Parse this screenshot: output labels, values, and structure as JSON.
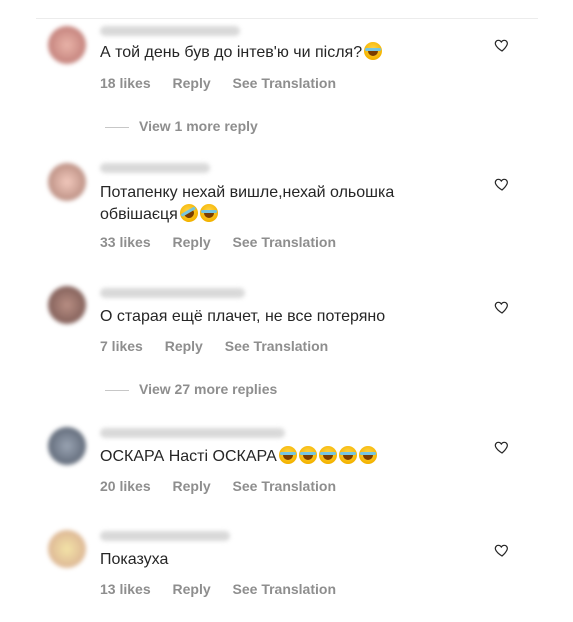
{
  "comments": [
    {
      "text": "А той день був до інтев'ю чи після?",
      "emojis": [
        "face-with-tears-of-joy"
      ],
      "likes": "18 likes",
      "reply": "Reply",
      "translate": "See Translation",
      "view_replies": "View 1 more reply"
    },
    {
      "text": "Потапенку нехай вишле,нехай ольошка обвішаєця",
      "emojis": [
        "rolling-on-floor-laughing",
        "face-with-tears-of-joy"
      ],
      "likes": "33 likes",
      "reply": "Reply",
      "translate": "See Translation"
    },
    {
      "text": "О старая ещё плачет, не все потеряно",
      "emojis": [],
      "likes": "7 likes",
      "reply": "Reply",
      "translate": "See Translation",
      "view_replies": "View 27 more replies"
    },
    {
      "text": "ОСКАРА Насті ОСКАРА",
      "emojis": [
        "face-with-tears-of-joy",
        "face-with-tears-of-joy",
        "face-with-tears-of-joy",
        "face-with-tears-of-joy",
        "face-with-tears-of-joy"
      ],
      "likes": "20 likes",
      "reply": "Reply",
      "translate": "See Translation"
    },
    {
      "text": "Показуха",
      "emojis": [],
      "likes": "13 likes",
      "reply": "Reply",
      "translate": "See Translation"
    }
  ],
  "icons": {
    "like": "heart-outline-icon"
  },
  "colors": {
    "meta": "#8e8e8e",
    "text": "#262626",
    "divider": "#ececec"
  }
}
